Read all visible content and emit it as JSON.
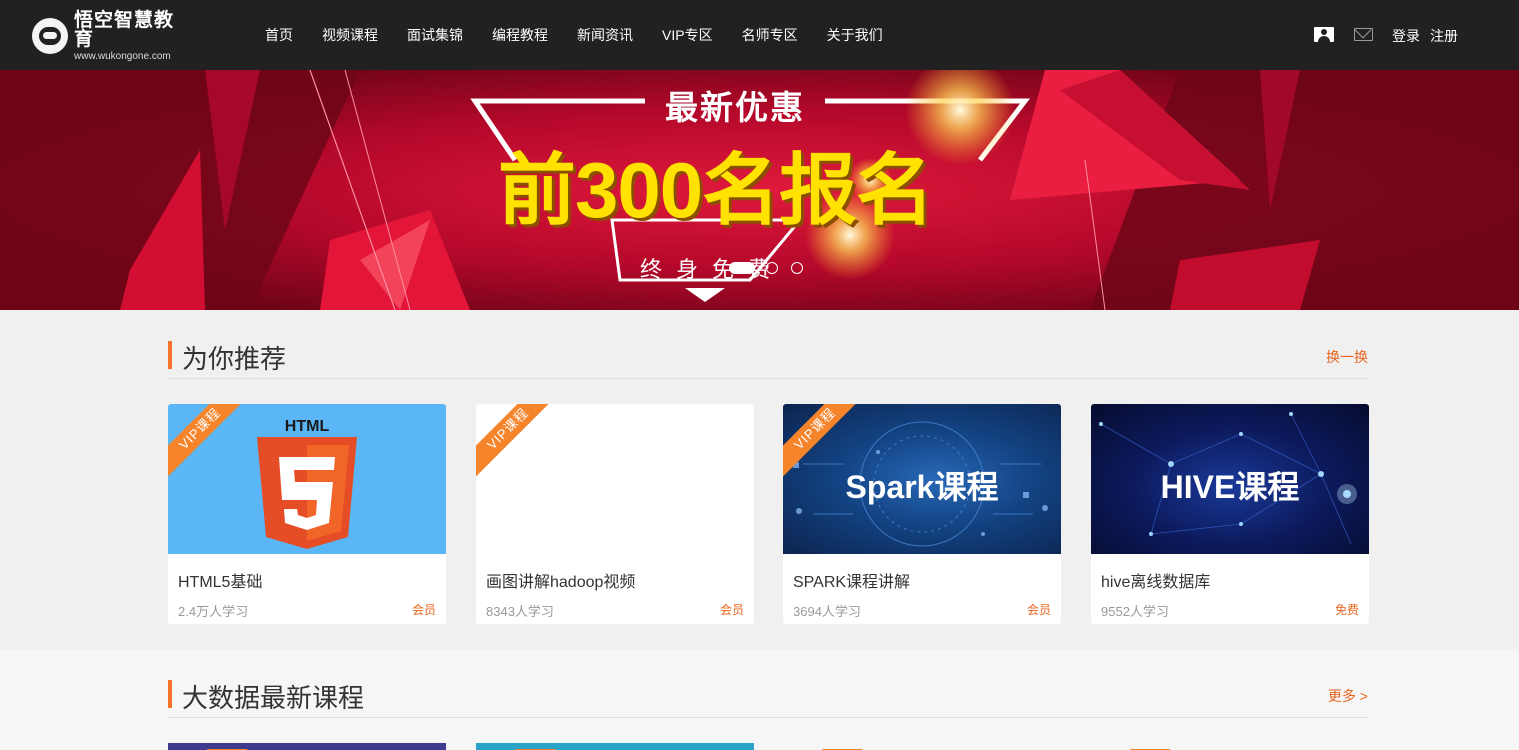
{
  "header": {
    "logo_name": "悟空智慧教育",
    "logo_url": "www.wukongone.com",
    "nav": [
      "首页",
      "视频课程",
      "面试集锦",
      "编程教程",
      "新闻资讯",
      "VIP专区",
      "名师专区",
      "关于我们"
    ],
    "login": "登录",
    "register": "注册"
  },
  "banner": {
    "slogan": "最新优惠",
    "headline": "前300名报名",
    "subline": "终身免费"
  },
  "recommend": {
    "title": "为你推荐",
    "action": "换一换",
    "vip_badge": "VIP课程",
    "courses": [
      {
        "thumb_text": "HTML",
        "title": "HTML5基础",
        "students": "2.4万人学习",
        "tag": "会员"
      },
      {
        "thumb_text": "",
        "title": "画图讲解hadoop视频",
        "students": "8343人学习",
        "tag": "会员"
      },
      {
        "thumb_text": "Spark课程",
        "title": "SPARK课程讲解",
        "students": "3694人学习",
        "tag": "会员"
      },
      {
        "thumb_text": "HIVE课程",
        "title": "hive离线数据库",
        "students": "9552人学习",
        "tag": "免费"
      }
    ]
  },
  "bigdata": {
    "title": "大数据最新课程",
    "action": "更多 >"
  },
  "colors": {
    "header_bg": "#212121",
    "accent": "#f5742a",
    "banner_red": "#c8102e",
    "headline_yellow": "#ffe200"
  }
}
